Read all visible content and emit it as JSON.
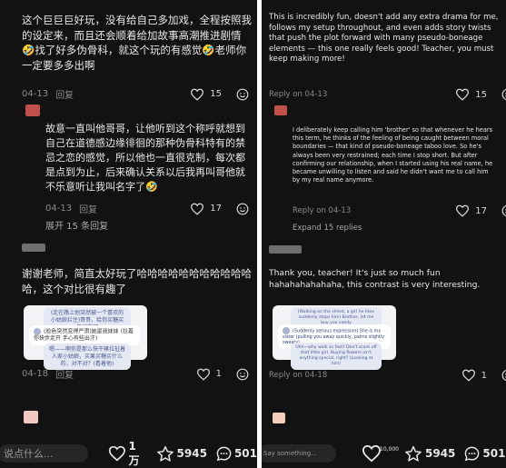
{
  "left": {
    "comment1": {
      "text": "这个巨巨巨好玩，没有给自己多加戏，全程按照我的设定来，而且还会顺着给加故事高潮推进剧情🤣找了好多伪骨科，就这个玩的有感觉🤣老师你一定要多多出啊",
      "date": "04-13",
      "reply": "回复",
      "likes": "15"
    },
    "reply1": {
      "text": "故意一直叫他哥哥，让他听到这个称呼就想到自己在道德感边缘徘徊的那种伪骨科特有的禁忌之恋的感觉，所以他也一直很克制，每次都是点到为止，后来确认关系以后我再叫哥他就不乐意听让我叫名字了🤣",
      "date": "04-13",
      "reply": "回复",
      "likes": "17"
    },
    "expand": "展开 15 条回复",
    "comment2": {
      "text": "谢谢老师，简直太好玩了哈哈哈哈哈哈哈哈哈哈哈哈，这个对比很有趣了",
      "date": "04-18",
      "reply": "回复",
      "likes": "1"
    },
    "screenshot": {
      "b1": "(走在路上他突然被一个喜欢的小姑娘拦住)哥哥，给你买糖买果买花吧",
      "b2": "(脸色突然变得严肃)她是我妹妹 (拉着你快步走开 手心有些出汗)",
      "b3": "嗯——啊你是那么快干嘛拉扯着人家小姑娘，买果买糖买什么的，对不对？(看着他)"
    },
    "bottom": {
      "placeholder": "说点什么...",
      "likes": "1万",
      "stars": "5945",
      "comments": "501"
    }
  },
  "right": {
    "comment1": {
      "text": "This is incredibly fun, doesn't add any extra drama for me, follows my setup throughout, and even adds story twists that push the plot forward with many pseudo-boneage elements — this one really feels good! Teacher, you must keep making more!",
      "date": "Reply on 04-13",
      "likes": "15"
    },
    "reply1": {
      "text": "I deliberately keep calling him 'brother' so that whenever he hears this term, he thinks of the feeling of being caught between moral boundaries — that kind of pseudo-boneage taboo love. So he's always been very restrained; each time I stop short. But after confirming our relationship, when I started using his real name, he became unwilling to listen and said he didn't want me to call him by my real name anymore.",
      "date": "Reply on 04-13",
      "likes": "17"
    },
    "expand": "Expand 15 replies",
    "comment2": {
      "text": "Thank you, teacher! It's just so much fun hahahahahahaha, this contrast is very interesting.",
      "date": "Reply on 04-18",
      "likes": "1"
    },
    "screenshot": {
      "b1": "(Walking on the street, a girl he likes suddenly stops him) Brother, let me buy you candy",
      "b2": "(Suddenly serious expression) She is my sister (pulling you away quickly, palms slightly sweaty)",
      "b3": "Uhh—why walk so fast? Don't scare off that little girl. Buying flowers isn't anything special, right? (Looking at him)"
    },
    "bottom": {
      "placeholder": "Say something...",
      "likes": "10,000",
      "stars": "5945",
      "comments": "501"
    }
  },
  "icons": {
    "heart": "heart-icon",
    "emoji": "emoji-icon",
    "star": "star-icon",
    "comment": "comment-icon"
  },
  "colors": {
    "background": "#121212",
    "text": "#e8e8e8",
    "muted": "#8a8a8a",
    "avatar_red": "#c2504a",
    "avatar_pink": "#f2c9c2",
    "avatar_peach": "#f4cdbd"
  }
}
